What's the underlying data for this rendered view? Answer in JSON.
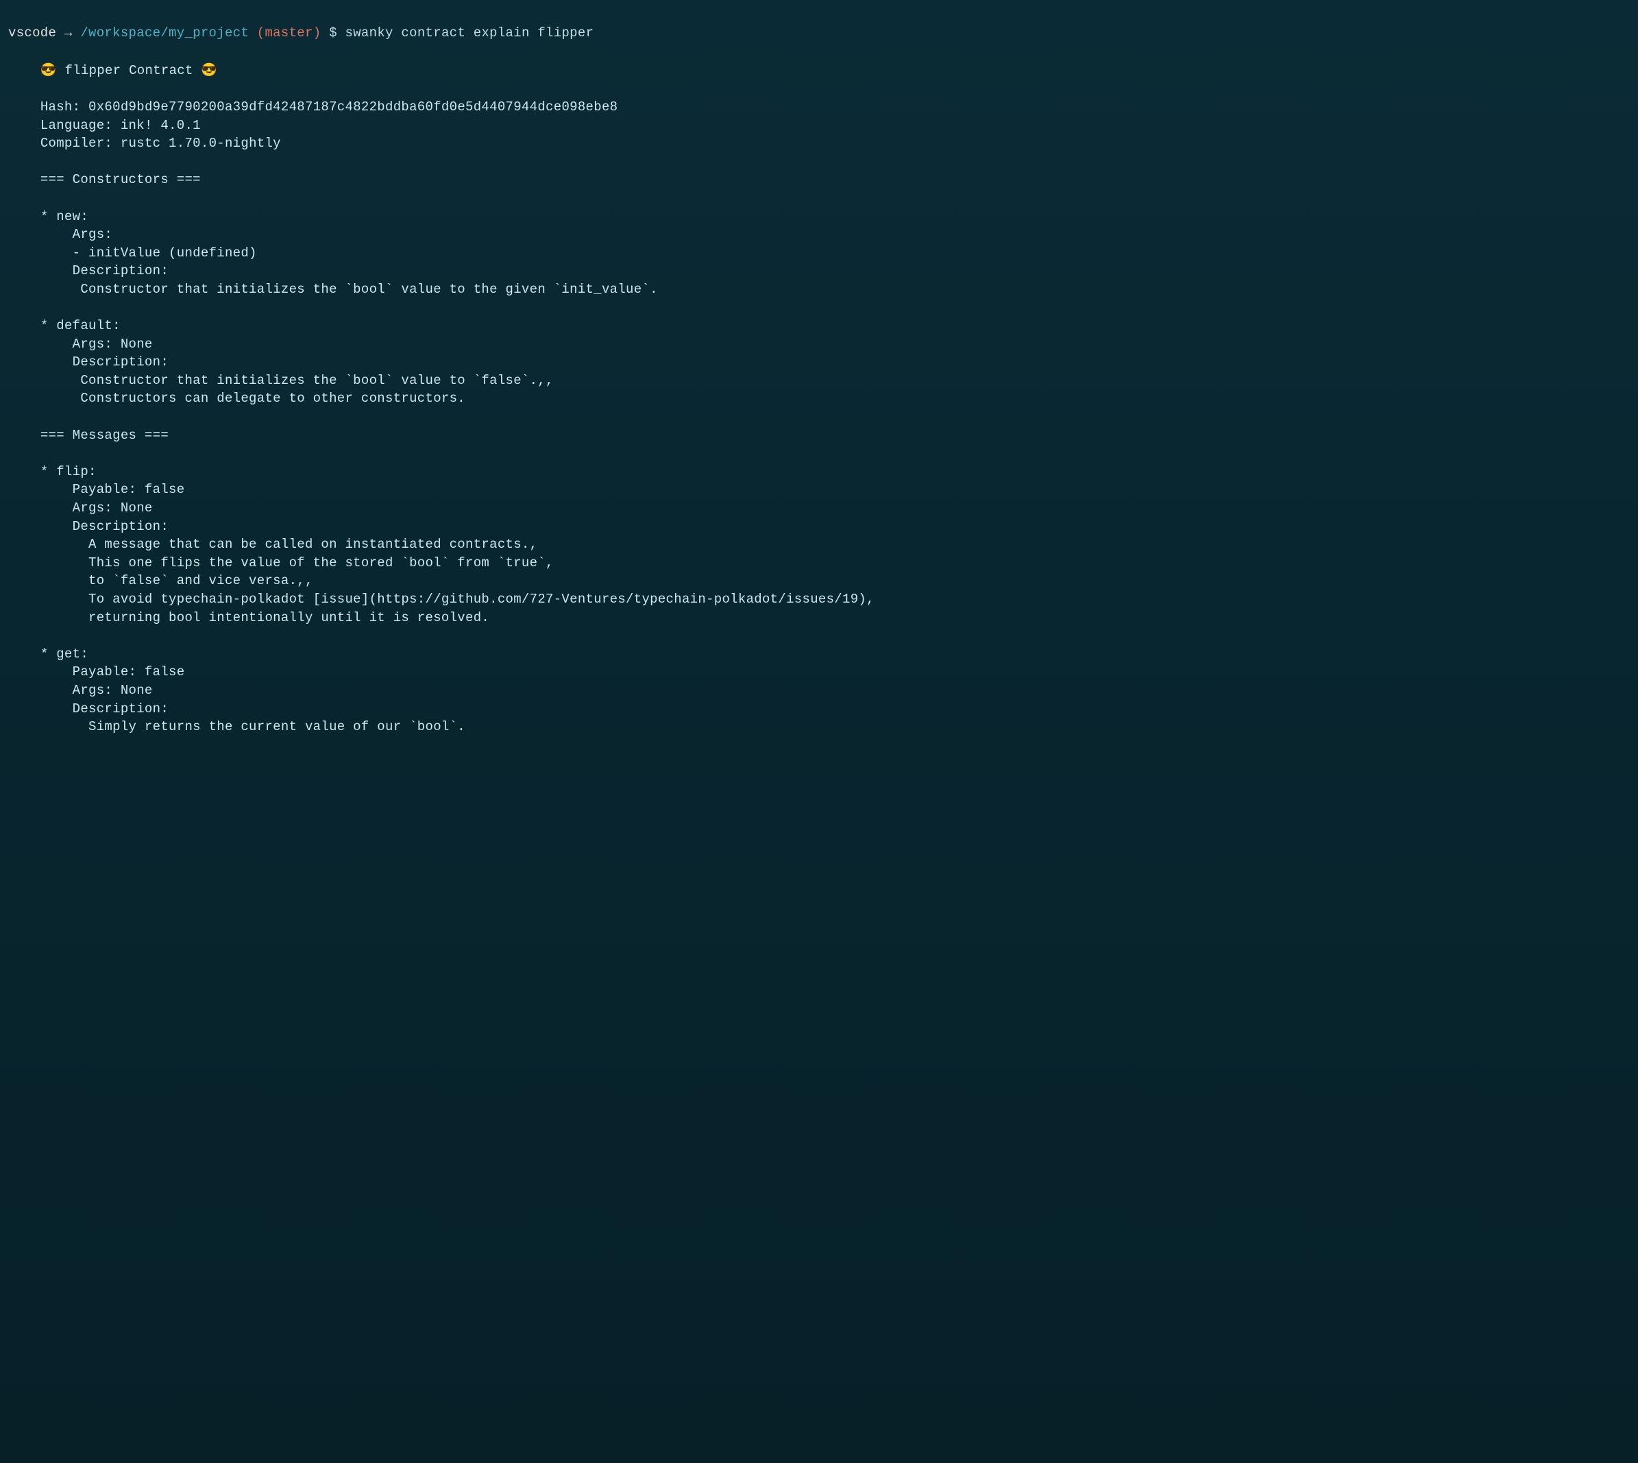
{
  "prompt": {
    "user": "vscode",
    "arrow": "→",
    "path": "/workspace/my_project",
    "branch_open": "(",
    "branch": "master",
    "branch_close": ")",
    "dollar": "$",
    "command": "swanky contract explain flipper"
  },
  "output": {
    "header_emoji_left": "😎",
    "header_text": "flipper Contract",
    "header_emoji_right": "😎",
    "hash_label": "Hash:",
    "hash_value": "0x60d9bd9e7790200a39dfd42487187c4822bddba60fd0e5d4407944dce098ebe8",
    "language_label": "Language:",
    "language_value": "ink! 4.0.1",
    "compiler_label": "Compiler:",
    "compiler_value": "rustc 1.70.0-nightly",
    "constructors_header": "=== Constructors ===",
    "constructors": {
      "c1_name": "* new:",
      "c1_args_label": "    Args:",
      "c1_arg1": "    - initValue (undefined)",
      "c1_desc_label": "    Description:",
      "c1_desc_line1": "     Constructor that initializes the `bool` value to the given `init_value`.",
      "c2_name": "* default:",
      "c2_args": "    Args: None",
      "c2_desc_label": "    Description:",
      "c2_desc_line1": "     Constructor that initializes the `bool` value to `false`.,,",
      "c2_desc_line2": "     Constructors can delegate to other constructors."
    },
    "messages_header": "=== Messages ===",
    "messages": {
      "m1_name": "* flip:",
      "m1_payable": "    Payable: false",
      "m1_args": "    Args: None",
      "m1_desc_label": "    Description:",
      "m1_desc_line1": "      A message that can be called on instantiated contracts.,",
      "m1_desc_line2": "      This one flips the value of the stored `bool` from `true`,",
      "m1_desc_line3": "      to `false` and vice versa.,,",
      "m1_desc_line4": "      To avoid typechain-polkadot [issue](https://github.com/727-Ventures/typechain-polkadot/issues/19),",
      "m1_desc_line5": "      returning bool intentionally until it is resolved.",
      "m2_name": "* get:",
      "m2_payable": "    Payable: false",
      "m2_args": "    Args: None",
      "m2_desc_label": "    Description:",
      "m2_desc_line1": "      Simply returns the current value of our `bool`."
    }
  }
}
